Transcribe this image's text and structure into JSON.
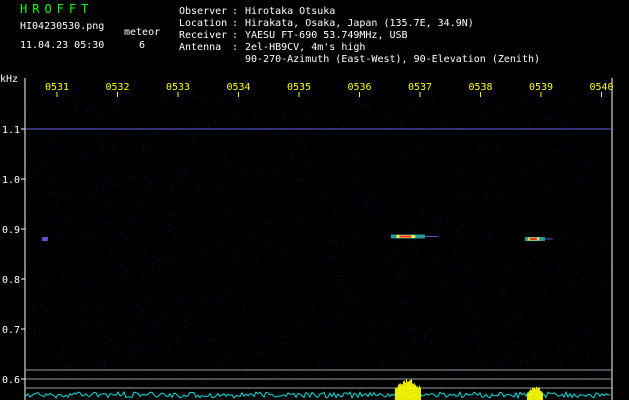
{
  "header": {
    "app_title": "HROFFT",
    "filename": "HI04230530.png",
    "datetime": "11.04.23 05:30",
    "meteor_label": "meteor",
    "meteor_count": "6",
    "observer_label": "Observer",
    "observer_value": "Hirotaka Otsuka",
    "location_label": "Location",
    "location_value": "Hirakata, Osaka, Japan (135.7E, 34.9N)",
    "receiver_label": "Receiver",
    "receiver_value": "YAESU FT-690 53.749MHz, USB",
    "antenna_label": "Antenna",
    "antenna_value": "2el-HB9CV, 4m's high",
    "antenna_value2": "90-270-Azimuth (East-West), 90-Elevation (Zenith)",
    "colon": ":"
  },
  "axes": {
    "y_unit": "kHz",
    "y_ticks": [
      "1.1",
      "1.0",
      "0.9",
      "0.8",
      "0.7",
      "0.6"
    ],
    "x_ticks": [
      "0531",
      "0532",
      "0533",
      "0534",
      "0535",
      "0536",
      "0537",
      "0538",
      "0539",
      "0540"
    ]
  },
  "colors": {
    "background": "#000000",
    "noise": "#1a1a8c",
    "carrier": "#6a6aff",
    "meteor_hot": "#ff3030",
    "meteor_warm": "#ffff40",
    "meteor_cool": "#40ffff",
    "level_base": "#00e0e0",
    "level_peak": "#ffff00",
    "title": "#00ff00",
    "text": "#ffffff",
    "ticks": "#ffff00"
  },
  "chart_data": {
    "type": "heatmap",
    "y_unit": "kHz",
    "xlim": [
      "0530",
      "0540"
    ],
    "ylim": [
      0.58,
      1.2
    ],
    "carrier_khz": 1.1,
    "meteors": [
      {
        "time": "0530.8",
        "freq_khz": 0.88,
        "strength": "weak"
      },
      {
        "time": "0536.8",
        "freq_khz": 0.885,
        "strength": "strong"
      },
      {
        "time": "0538.9",
        "freq_khz": 0.88,
        "strength": "medium"
      }
    ],
    "level_bursts": [
      {
        "time": "0536.8",
        "strength": "strong"
      },
      {
        "time": "0538.9",
        "strength": "medium"
      }
    ]
  }
}
